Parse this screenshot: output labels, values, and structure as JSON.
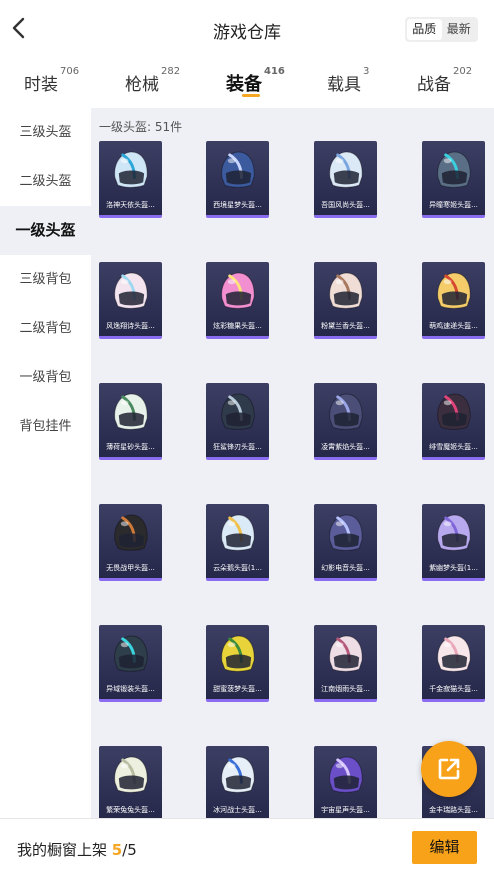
{
  "header": {
    "title": "游戏仓库",
    "sort_options": [
      {
        "label": "品质",
        "active": true
      },
      {
        "label": "最新",
        "active": false
      }
    ]
  },
  "tabs": [
    {
      "label": "时装",
      "count": "706",
      "active": false
    },
    {
      "label": "枪械",
      "count": "282",
      "active": false
    },
    {
      "label": "装备",
      "count": "416",
      "active": true
    },
    {
      "label": "载具",
      "count": "3",
      "active": false
    },
    {
      "label": "战备",
      "count": "202",
      "active": false
    }
  ],
  "colors": {
    "accent": "#f8a21a",
    "card_bg": "#2f3155",
    "card_border": "#8a6cf0",
    "content_bg": "#eef0f5"
  },
  "sidebar": {
    "items": [
      {
        "label": "三级头盔",
        "active": false
      },
      {
        "label": "二级头盔",
        "active": false
      },
      {
        "label": "一级头盔",
        "active": true
      },
      {
        "label": "三级背包",
        "active": false
      },
      {
        "label": "二级背包",
        "active": false
      },
      {
        "label": "一级背包",
        "active": false
      },
      {
        "label": "背包挂件",
        "active": false
      }
    ]
  },
  "content": {
    "section_label": "一级头盔: 51件",
    "items": [
      {
        "name": "洛神天依头盔...",
        "color": "#cfe6f7",
        "accent": "#2aa6d8"
      },
      {
        "name": "西境星梦头盔...",
        "color": "#3c5a9e",
        "accent": "#c9d6ff"
      },
      {
        "name": "吾国风尚头盔...",
        "color": "#dbe8f6",
        "accent": "#7aa6e0"
      },
      {
        "name": "异瞳寒姬头盔...",
        "color": "#5a6f86",
        "accent": "#39d0e0"
      },
      {
        "name": "风逸翔诗头盔...",
        "color": "#f3e4ef",
        "accent": "#9fd8f0"
      },
      {
        "name": "炫彩糖果头盔...",
        "color": "#f18fd0",
        "accent": "#ffe27a"
      },
      {
        "name": "粉黛兰香头盔...",
        "color": "#f0ddd6",
        "accent": "#a7785e"
      },
      {
        "name": "萌鸡速递头盔...",
        "color": "#f4cd6a",
        "accent": "#d5482f"
      },
      {
        "name": "薄荷星砂头盔...",
        "color": "#e8f2ea",
        "accent": "#4a8a5e"
      },
      {
        "name": "狂鲨锋刃头盔...",
        "color": "#2f3a4a",
        "accent": "#b7c8d8"
      },
      {
        "name": "凌霄紫焰头盔...",
        "color": "#4b4f78",
        "accent": "#9aa6e6"
      },
      {
        "name": "绯雪魔姬头盔...",
        "color": "#3b2f3f",
        "accent": "#e0437a"
      },
      {
        "name": "无畏战甲头盔...",
        "color": "#2b2b2e",
        "accent": "#d07a3a"
      },
      {
        "name": "云朵鹅头盔(1...",
        "color": "#dbeaf7",
        "accent": "#f0c04a"
      },
      {
        "name": "幻影电音头盔...",
        "color": "#5b5d9a",
        "accent": "#b7c3ff"
      },
      {
        "name": "紫幽梦头盔(1...",
        "color": "#b8a8ee",
        "accent": "#7f65d8"
      },
      {
        "name": "异域锻装头盔...",
        "color": "#2e3e4a",
        "accent": "#3bd6e0"
      },
      {
        "name": "甜蜜菠梦头盔...",
        "color": "#e8d43a",
        "accent": "#3c8a3a"
      },
      {
        "name": "江南烟雨头盔...",
        "color": "#efdde6",
        "accent": "#b5587a"
      },
      {
        "name": "千金寂猫头盔...",
        "color": "#f7e6ea",
        "accent": "#e8a6b8"
      },
      {
        "name": "繁荣兔兔头盔...",
        "color": "#eef0df",
        "accent": "#b8bca0"
      },
      {
        "name": "冰河战士头盔...",
        "color": "#e6eef8",
        "accent": "#3b6fd8"
      },
      {
        "name": "宇宙星声头盔...",
        "color": "#6a4fc8",
        "accent": "#d8c8ff"
      },
      {
        "name": "金丰瑞路头盔...",
        "color": "#d8dce6",
        "accent": "#e8b84a"
      }
    ]
  },
  "fab": {
    "icon": "share-external-icon"
  },
  "footer": {
    "label_prefix": "我的橱窗上架",
    "shelf_count": "5",
    "shelf_total": "/5",
    "edit_label": "编辑"
  }
}
